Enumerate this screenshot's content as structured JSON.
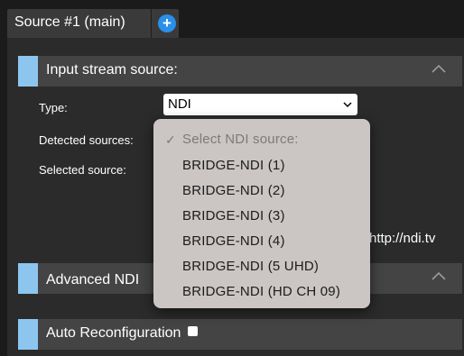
{
  "tab": {
    "label": "Source #1 (main)",
    "add_icon": "plus-circle-icon",
    "add_symbol": "+"
  },
  "sections": {
    "input": {
      "title": "Input stream source:",
      "collapse_icon": "chevron-up-icon"
    },
    "advanced": {
      "title": "Advanced NDI",
      "collapse_icon": "chevron-up-icon"
    },
    "auto": {
      "title": "Auto Reconfiguration",
      "checked": false
    }
  },
  "fields": {
    "type_label": "Type:",
    "type_value": "NDI",
    "detected_label": "Detected sources:",
    "selected_label": "Selected source:",
    "link_text": "http://ndi.tv"
  },
  "menu": {
    "check_symbol": "✓",
    "placeholder": "Select NDI source:",
    "items": [
      "BRIDGE-NDI (1)",
      "BRIDGE-NDI (2)",
      "BRIDGE-NDI (3)",
      "BRIDGE-NDI (4)",
      "BRIDGE-NDI (5 UHD)",
      "BRIDGE-NDI (HD CH 09)"
    ]
  },
  "colors": {
    "accent": "#8cc6ef",
    "add_button": "#2a8fea",
    "menu_background": "#cbc5c4"
  }
}
